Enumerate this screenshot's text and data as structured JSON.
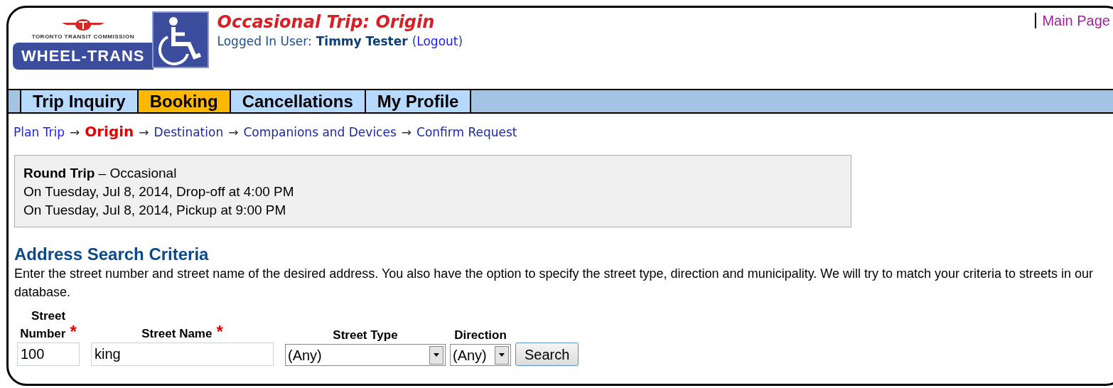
{
  "logo": {
    "agency": "TORONTO TRANSIT COMMISSION",
    "name": "WHEEL-TRANS"
  },
  "header": {
    "title": "Occasional Trip: Origin",
    "user_label": "Logged In User:",
    "user_name": "Timmy Tester",
    "logout_open": "(",
    "logout": "Logout",
    "logout_close": ")",
    "main_page": "Main Page"
  },
  "tabs": [
    {
      "label": "Trip Inquiry",
      "selected": false
    },
    {
      "label": "Booking",
      "selected": true
    },
    {
      "label": "Cancellations",
      "selected": false
    },
    {
      "label": "My Profile",
      "selected": false
    }
  ],
  "steps": [
    {
      "label": "Plan Trip",
      "selected": false,
      "visited": true
    },
    {
      "label": "Origin",
      "selected": true,
      "visited": false
    },
    {
      "label": "Destination",
      "selected": false,
      "visited": false
    },
    {
      "label": "Companions and Devices",
      "selected": false,
      "visited": false
    },
    {
      "label": "Confirm Request",
      "selected": false,
      "visited": false
    }
  ],
  "step_separator": [
    "→",
    "→",
    "→",
    "→"
  ],
  "trip_summary": {
    "first_line": "**Round Trip** – Occasional",
    "lines": [
      "On Tuesday, Jul 8, 2014, Drop-off at 4:00 PM",
      "On Tuesday, Jul 8, 2014, Pickup at 9:00 PM"
    ]
  },
  "section": {
    "heading": "Address Search Criteria",
    "description": "Enter the street number and street name of the desired address. You also have the option to specify the street type, direction and municipality. We will try to match your criteria to streets in our database."
  },
  "fields": [
    {
      "kind": "text",
      "label": [
        "Street",
        "Number"
      ],
      "mark": "*",
      "value": "100"
    },
    {
      "kind": "text",
      "label": [
        "Street Name"
      ],
      "mark": "*",
      "value": "king"
    },
    {
      "kind": "select",
      "label": [
        "Street Type"
      ],
      "value": "(Any)"
    },
    {
      "kind": "select",
      "label": [
        "Direction"
      ],
      "value": "(Any)"
    }
  ],
  "search_button": "Search"
}
